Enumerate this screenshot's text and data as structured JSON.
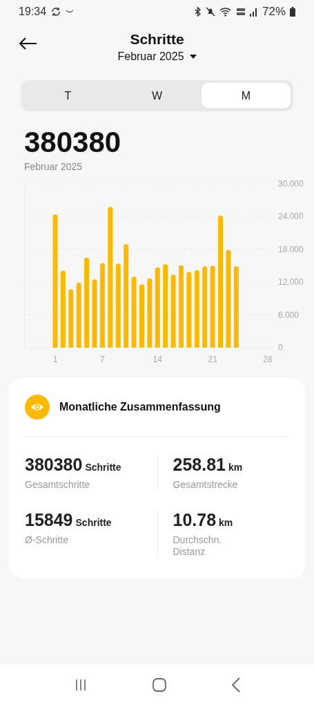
{
  "status_bar": {
    "time": "19:34",
    "battery": "72%"
  },
  "header": {
    "title": "Schritte",
    "period": "Februar 2025"
  },
  "tabs": [
    {
      "label": "T",
      "selected": false
    },
    {
      "label": "W",
      "selected": false
    },
    {
      "label": "M",
      "selected": true
    }
  ],
  "total": {
    "value": "380380",
    "period": "Februar 2025"
  },
  "chart_data": {
    "type": "bar",
    "categories": [
      "1",
      null,
      null,
      null,
      null,
      null,
      "7",
      null,
      null,
      null,
      null,
      null,
      null,
      "14",
      null,
      null,
      null,
      null,
      null,
      null,
      "21",
      null,
      null,
      null,
      null,
      null,
      null,
      "28"
    ],
    "grid": true,
    "series": [
      {
        "color": "#fbb900",
        "values": [
          24.4,
          14.1,
          10.7,
          11.9,
          16.5,
          12.5,
          15.5,
          25.8,
          15.4,
          19.0,
          13.0,
          11.6,
          12.7,
          14.7,
          15.3,
          13.4,
          15.1,
          13.9,
          14.2,
          14.9,
          15.0,
          24.2,
          17.9,
          14.9,
          null,
          null,
          null,
          null
        ]
      }
    ],
    "ylim": [
      0,
      30
    ],
    "yticks": [
      {
        "value": 0,
        "label": "0"
      },
      {
        "value": 6,
        "label": "6.000"
      },
      {
        "value": 12,
        "label": "12.000"
      },
      {
        "value": 18,
        "label": "18.000"
      },
      {
        "value": 24,
        "label": "24.000"
      },
      {
        "value": 30,
        "label": "30.000"
      }
    ]
  },
  "summary": {
    "title": "Monatliche Zusammenfassung",
    "stats": [
      {
        "value": "380380",
        "unit": "Schritte",
        "label": "Gesamtschritte"
      },
      {
        "value": "258.81",
        "unit": "km",
        "label": "Gesamtstrecke"
      },
      {
        "value": "15849",
        "unit": "Schritte",
        "label": "Ø-Schritte"
      },
      {
        "value": "10.78",
        "unit": "km",
        "label": "Durchschn. Distanz"
      }
    ]
  }
}
